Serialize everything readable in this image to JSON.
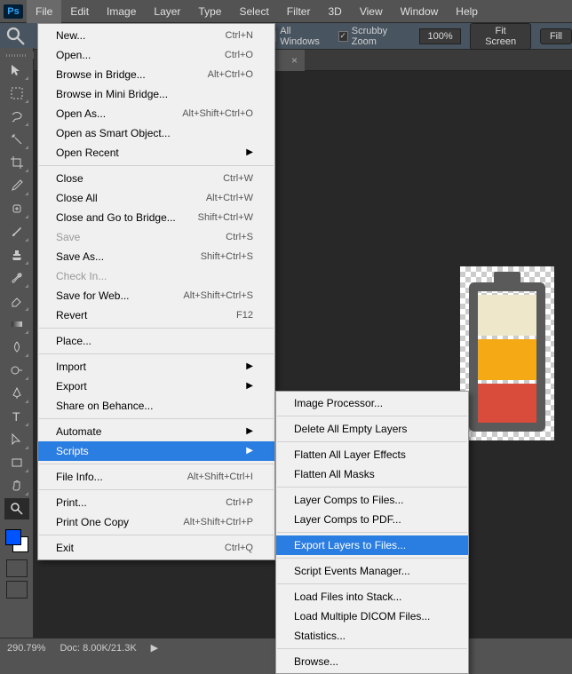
{
  "menubar": {
    "items": [
      "File",
      "Edit",
      "Image",
      "Layer",
      "Type",
      "Select",
      "Filter",
      "3D",
      "View",
      "Window",
      "Help"
    ]
  },
  "options": {
    "all_windows": "All Windows",
    "scrubby": "Scrubby Zoom",
    "zoom_amount": "100%",
    "fit_screen": "Fit Screen",
    "fill": "Fill"
  },
  "tab": {
    "close": "×"
  },
  "file_menu": {
    "g1": [
      {
        "label": "New...",
        "sc": "Ctrl+N"
      },
      {
        "label": "Open...",
        "sc": "Ctrl+O"
      },
      {
        "label": "Browse in Bridge...",
        "sc": "Alt+Ctrl+O"
      },
      {
        "label": "Browse in Mini Bridge...",
        "sc": ""
      },
      {
        "label": "Open As...",
        "sc": "Alt+Shift+Ctrl+O"
      },
      {
        "label": "Open as Smart Object...",
        "sc": ""
      },
      {
        "label": "Open Recent",
        "sc": "",
        "sub": true
      }
    ],
    "g2": [
      {
        "label": "Close",
        "sc": "Ctrl+W"
      },
      {
        "label": "Close All",
        "sc": "Alt+Ctrl+W"
      },
      {
        "label": "Close and Go to Bridge...",
        "sc": "Shift+Ctrl+W"
      },
      {
        "label": "Save",
        "sc": "Ctrl+S",
        "disabled": true
      },
      {
        "label": "Save As...",
        "sc": "Shift+Ctrl+S"
      },
      {
        "label": "Check In...",
        "sc": "",
        "disabled": true
      },
      {
        "label": "Save for Web...",
        "sc": "Alt+Shift+Ctrl+S"
      },
      {
        "label": "Revert",
        "sc": "F12"
      }
    ],
    "g3": [
      {
        "label": "Place...",
        "sc": ""
      }
    ],
    "g4": [
      {
        "label": "Import",
        "sc": "",
        "sub": true
      },
      {
        "label": "Export",
        "sc": "",
        "sub": true
      },
      {
        "label": "Share on Behance...",
        "sc": ""
      }
    ],
    "g5": [
      {
        "label": "Automate",
        "sc": "",
        "sub": true
      },
      {
        "label": "Scripts",
        "sc": "",
        "sub": true,
        "hover": true
      }
    ],
    "g6": [
      {
        "label": "File Info...",
        "sc": "Alt+Shift+Ctrl+I"
      }
    ],
    "g7": [
      {
        "label": "Print...",
        "sc": "Ctrl+P"
      },
      {
        "label": "Print One Copy",
        "sc": "Alt+Shift+Ctrl+P"
      }
    ],
    "g8": [
      {
        "label": "Exit",
        "sc": "Ctrl+Q"
      }
    ]
  },
  "scripts_menu": {
    "g1": [
      {
        "label": "Image Processor..."
      }
    ],
    "g2": [
      {
        "label": "Delete All Empty Layers"
      }
    ],
    "g3": [
      {
        "label": "Flatten All Layer Effects"
      },
      {
        "label": "Flatten All Masks"
      }
    ],
    "g4": [
      {
        "label": "Layer Comps to Files..."
      },
      {
        "label": "Layer Comps to PDF..."
      }
    ],
    "g5": [
      {
        "label": "Export Layers to Files...",
        "hover": true
      }
    ],
    "g6": [
      {
        "label": "Script Events Manager..."
      }
    ],
    "g7": [
      {
        "label": "Load Files into Stack..."
      },
      {
        "label": "Load Multiple DICOM Files..."
      },
      {
        "label": "Statistics..."
      }
    ],
    "g8": [
      {
        "label": "Browse..."
      }
    ]
  },
  "status": {
    "zoom": "290.79%",
    "doc": "Doc: 8.00K/21.3K"
  }
}
